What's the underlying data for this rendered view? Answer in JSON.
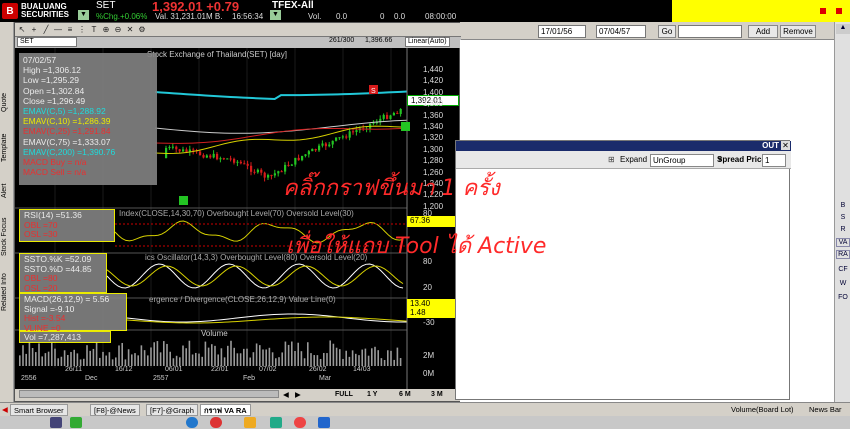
{
  "topbar": {
    "logo_mark": "B",
    "logo_text_1": "BUALUANG",
    "logo_text_2": "SECURITIES",
    "symbol": "SET",
    "price_big": "1,392.01 +0.79",
    "chg_label": "%Chg.+0.06%",
    "val_label": "Val. 31,231.01M B.",
    "time": "16:56:34",
    "tfex": "TFEX-All",
    "vol_label": "Vol.",
    "vol_value": "0.0",
    "zero1": "0",
    "zero2": "0.0",
    "tfex_time": "08:00:00"
  },
  "toolbar2": {
    "date_from": "17/01/56",
    "date_to": "07/04/57",
    "go_label": "Go",
    "add_label": "Add",
    "remove_label": "Remove"
  },
  "left_tabs": [
    "Quote",
    "Template",
    "Alert",
    "Stock Focus",
    "Related Info"
  ],
  "chart": {
    "symbol_field": "SET",
    "counter": "261/300",
    "last_price": "1,396.66",
    "scale_mode": "Linear(Auto)",
    "title": "Stock Exchange of Thailand(SET) [day]",
    "price_tag": "1,392.01",
    "rsi_tag": "67.36",
    "macd_tag1": "13.40",
    "macd_tag2": "1.48",
    "info": {
      "date": "07/02/57",
      "high": "High  =1,306.12",
      "low": "Low   =1,295.29",
      "open": "Open  =1,302.84",
      "close": "Close  =1,296.49",
      "ema5": "EMAV(C,5)   =1,288.92",
      "ema10": "EMAV(C,10)   =1,286.39",
      "ema25": "EMAV(C,25)   =1,291.84",
      "ema75": "EMAV(C,75)   =1,333.07",
      "ema200": "EMAV(C,200)   =1,390.76",
      "macd_buy": "MACD Buy  = n/a",
      "macd_sell": "MACD Sell  = n/a"
    },
    "rsi_panel": {
      "title": "Index(CLOSE,14,30,70) Overbought Level(70) Oversold Level(30)",
      "v1": "RSI(14)    =51.36",
      "v2": "OBL      =70",
      "v3": "OSL      =30",
      "axis": [
        "80",
        "20"
      ]
    },
    "sto_panel": {
      "title": "ics Oscillator(14,3,3) Overbought Level(80) Oversold Level(20)",
      "v1": "SSTO.%K   =52.09",
      "v2": "SSTO.%D   =44.85",
      "v3": "OBL      =80",
      "v4": "OSL      =20",
      "axis": [
        "80",
        "20"
      ]
    },
    "macd_panel": {
      "title": "ergence / Divergence(CLOSE,26,12,9) Value Line(0)",
      "v1": "MACD(26,12,9)  = 5.56",
      "v2": "Signal   =-9.10",
      "v3": "Hist     =-3.54",
      "v4": "VLINE    =0",
      "axis": [
        "-30"
      ]
    },
    "vol_panel": {
      "title": "Volume",
      "v1": "Vol   =7,287,413",
      "axis": [
        "2M",
        "0M"
      ]
    },
    "price_axis": [
      "1,440",
      "1,420",
      "1,400",
      "1,380",
      "1,360",
      "1,340",
      "1,320",
      "1,300",
      "1,280",
      "1,260",
      "1,240",
      "1,220",
      "1,200"
    ],
    "x_labels": [
      "26/11",
      "16/12",
      "06/01",
      "22/01",
      "07/02",
      "26/02",
      "14/03"
    ],
    "x_labels_bottom": [
      "2556",
      "Dec",
      "2557",
      "Feb",
      "Mar"
    ],
    "period_buttons": [
      "FULL",
      "1 Y",
      "6 M",
      "3 M"
    ]
  },
  "out_panel": {
    "title": "OUT",
    "expand_label": "Expand",
    "group": "UnGroup",
    "spread_label": "Spread Price :",
    "spread_value": "1"
  },
  "right_letters": [
    "B",
    "S",
    "R",
    "VA",
    "RA",
    "CF",
    "W",
    "FO"
  ],
  "overlay": {
    "line1": "คลิ๊กกราฟขึ้นมา 1 ครั้ง",
    "line2": "เพื่อให้แถบ Tool ได้ Active"
  },
  "statusbar": {
    "smart_browser": "Smart Browser",
    "tab1": "[F8]-@News",
    "tab2": "[F7]-@Graph",
    "tab3": "กราฟ VA RA",
    "volume_board": "Volume(Board Lot)",
    "news_bar": "News Bar"
  },
  "colors": {
    "overlay": "#ff2a2a",
    "ema_cyan": "#22c8d8",
    "ema_red": "#d02020",
    "ema_white": "#cccccc",
    "ema_yellow": "#d6d000",
    "candle_up": "#23c423",
    "candle_down": "#d81b1b"
  }
}
